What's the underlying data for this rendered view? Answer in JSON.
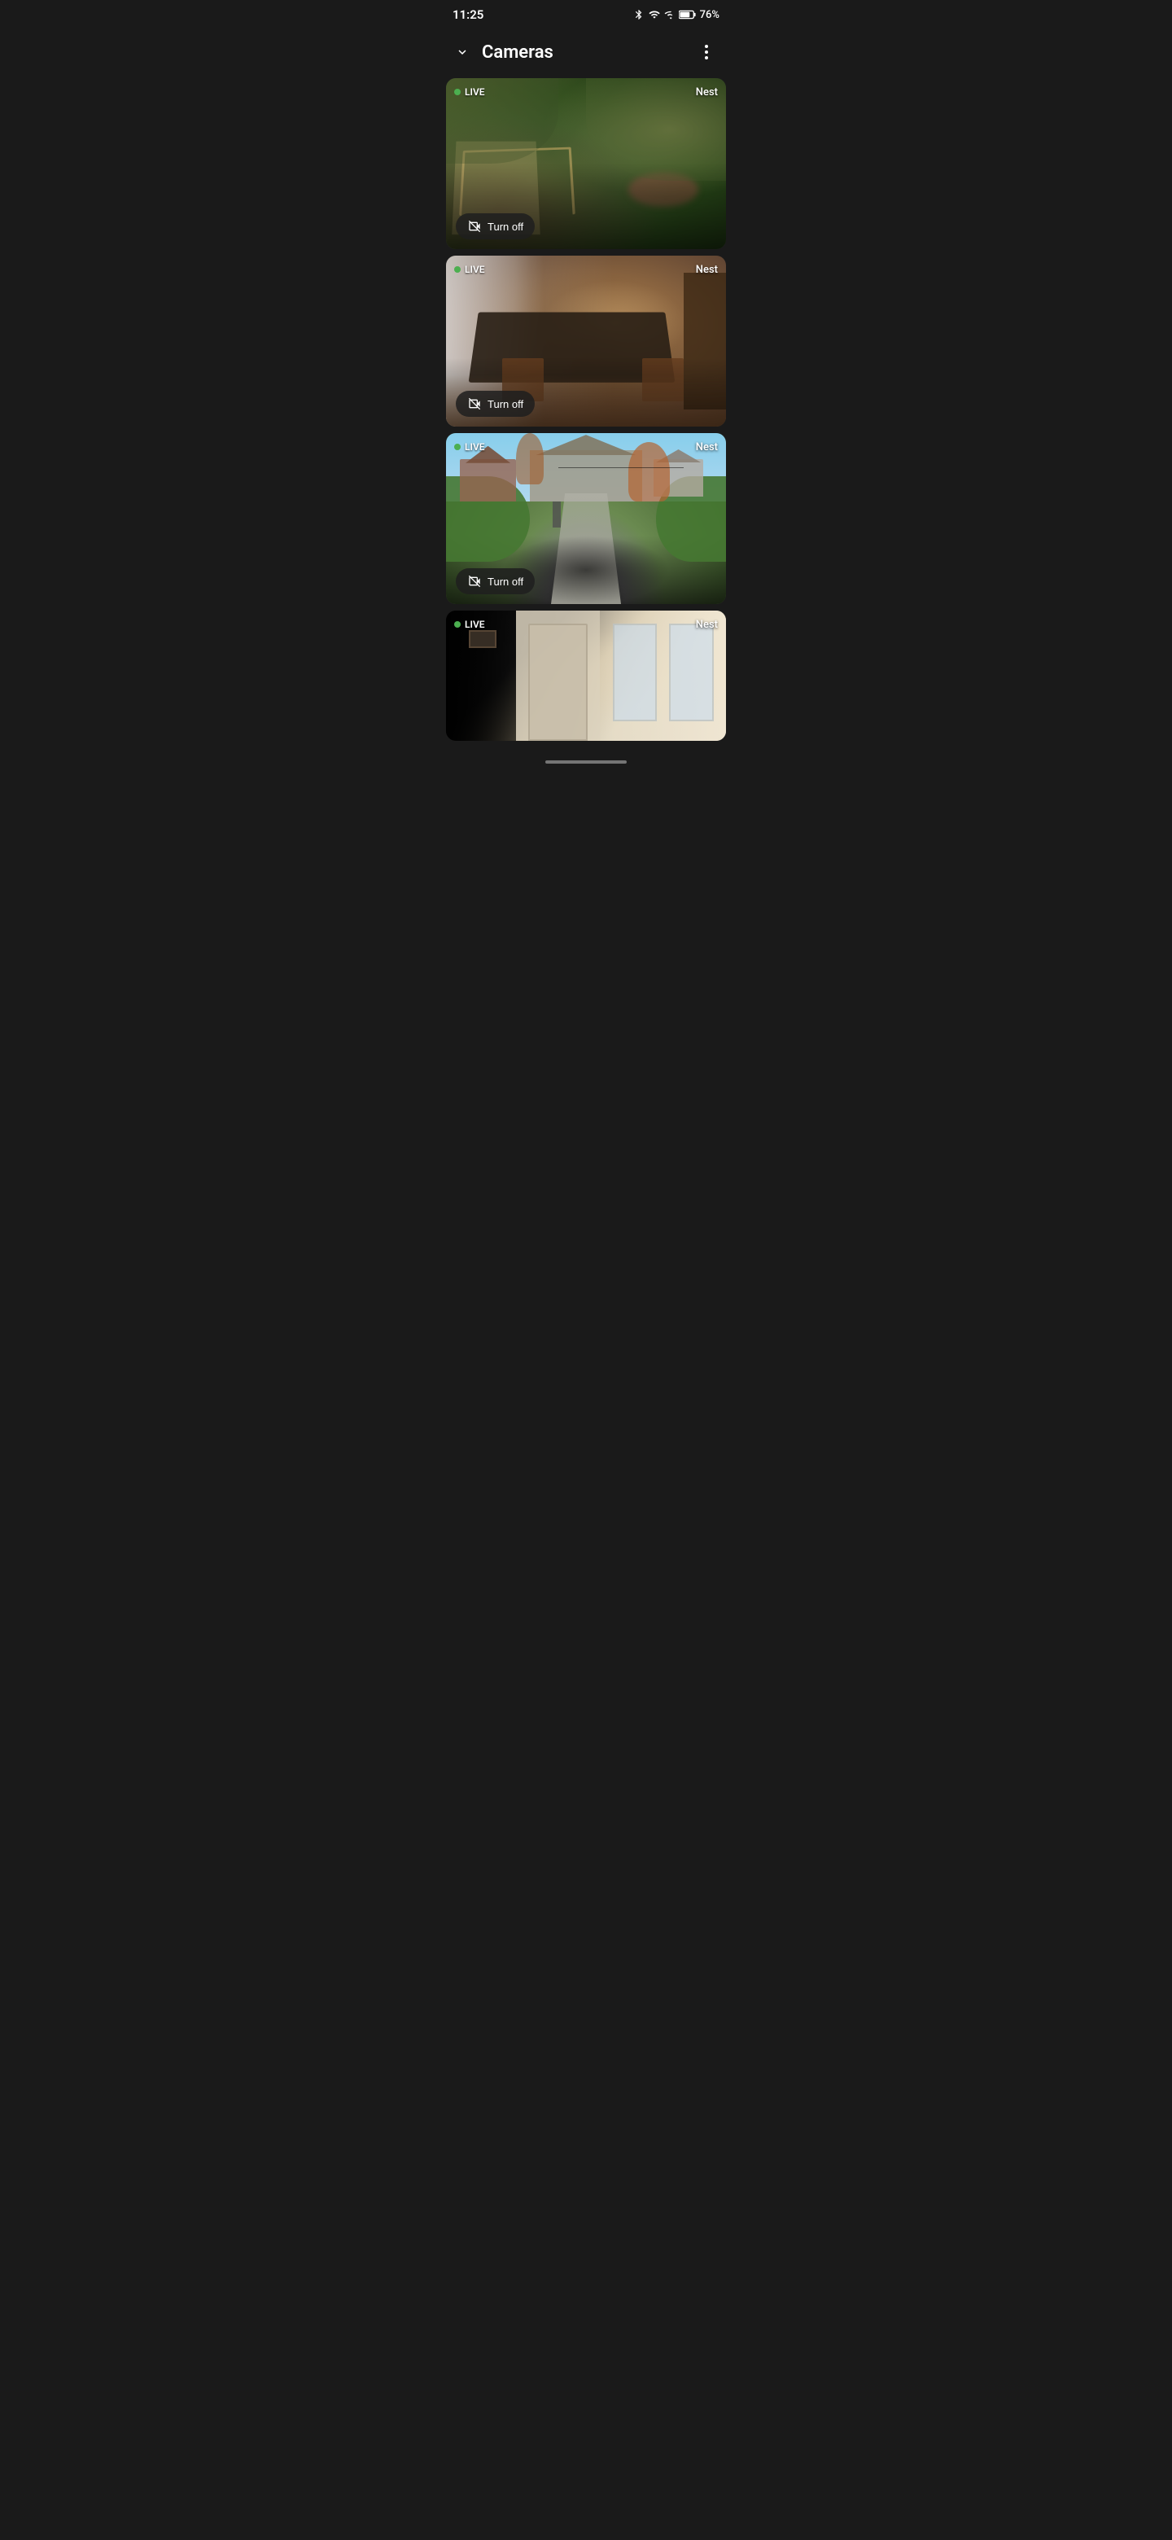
{
  "statusBar": {
    "time": "11:25",
    "battery": "76%",
    "batteryIcon": "battery-icon",
    "wifiIcon": "wifi-icon",
    "signalIcon": "signal-icon",
    "bluetoothIcon": "bluetooth-icon"
  },
  "header": {
    "title": "Cameras",
    "chevronIcon": "chevron-down-icon",
    "moreIcon": "more-menu-icon"
  },
  "cameras": [
    {
      "id": "cam1",
      "feedType": "backyard",
      "isLive": true,
      "liveLabel": "LIVE",
      "nestLabel": "Nest",
      "turnOffLabel": "Turn off",
      "turnOffIcon": "camera-off-icon"
    },
    {
      "id": "cam2",
      "feedType": "dining",
      "isLive": true,
      "liveLabel": "LIVE",
      "nestLabel": "Nest",
      "turnOffLabel": "Turn off",
      "turnOffIcon": "camera-off-icon"
    },
    {
      "id": "cam3",
      "feedType": "driveway",
      "isLive": true,
      "liveLabel": "LIVE",
      "nestLabel": "Nest",
      "turnOffLabel": "Turn off",
      "turnOffIcon": "camera-off-icon"
    },
    {
      "id": "cam4",
      "feedType": "interior",
      "isLive": true,
      "liveLabel": "LIVE",
      "nestLabel": "Nest",
      "turnOffLabel": null,
      "turnOffIcon": null
    }
  ]
}
